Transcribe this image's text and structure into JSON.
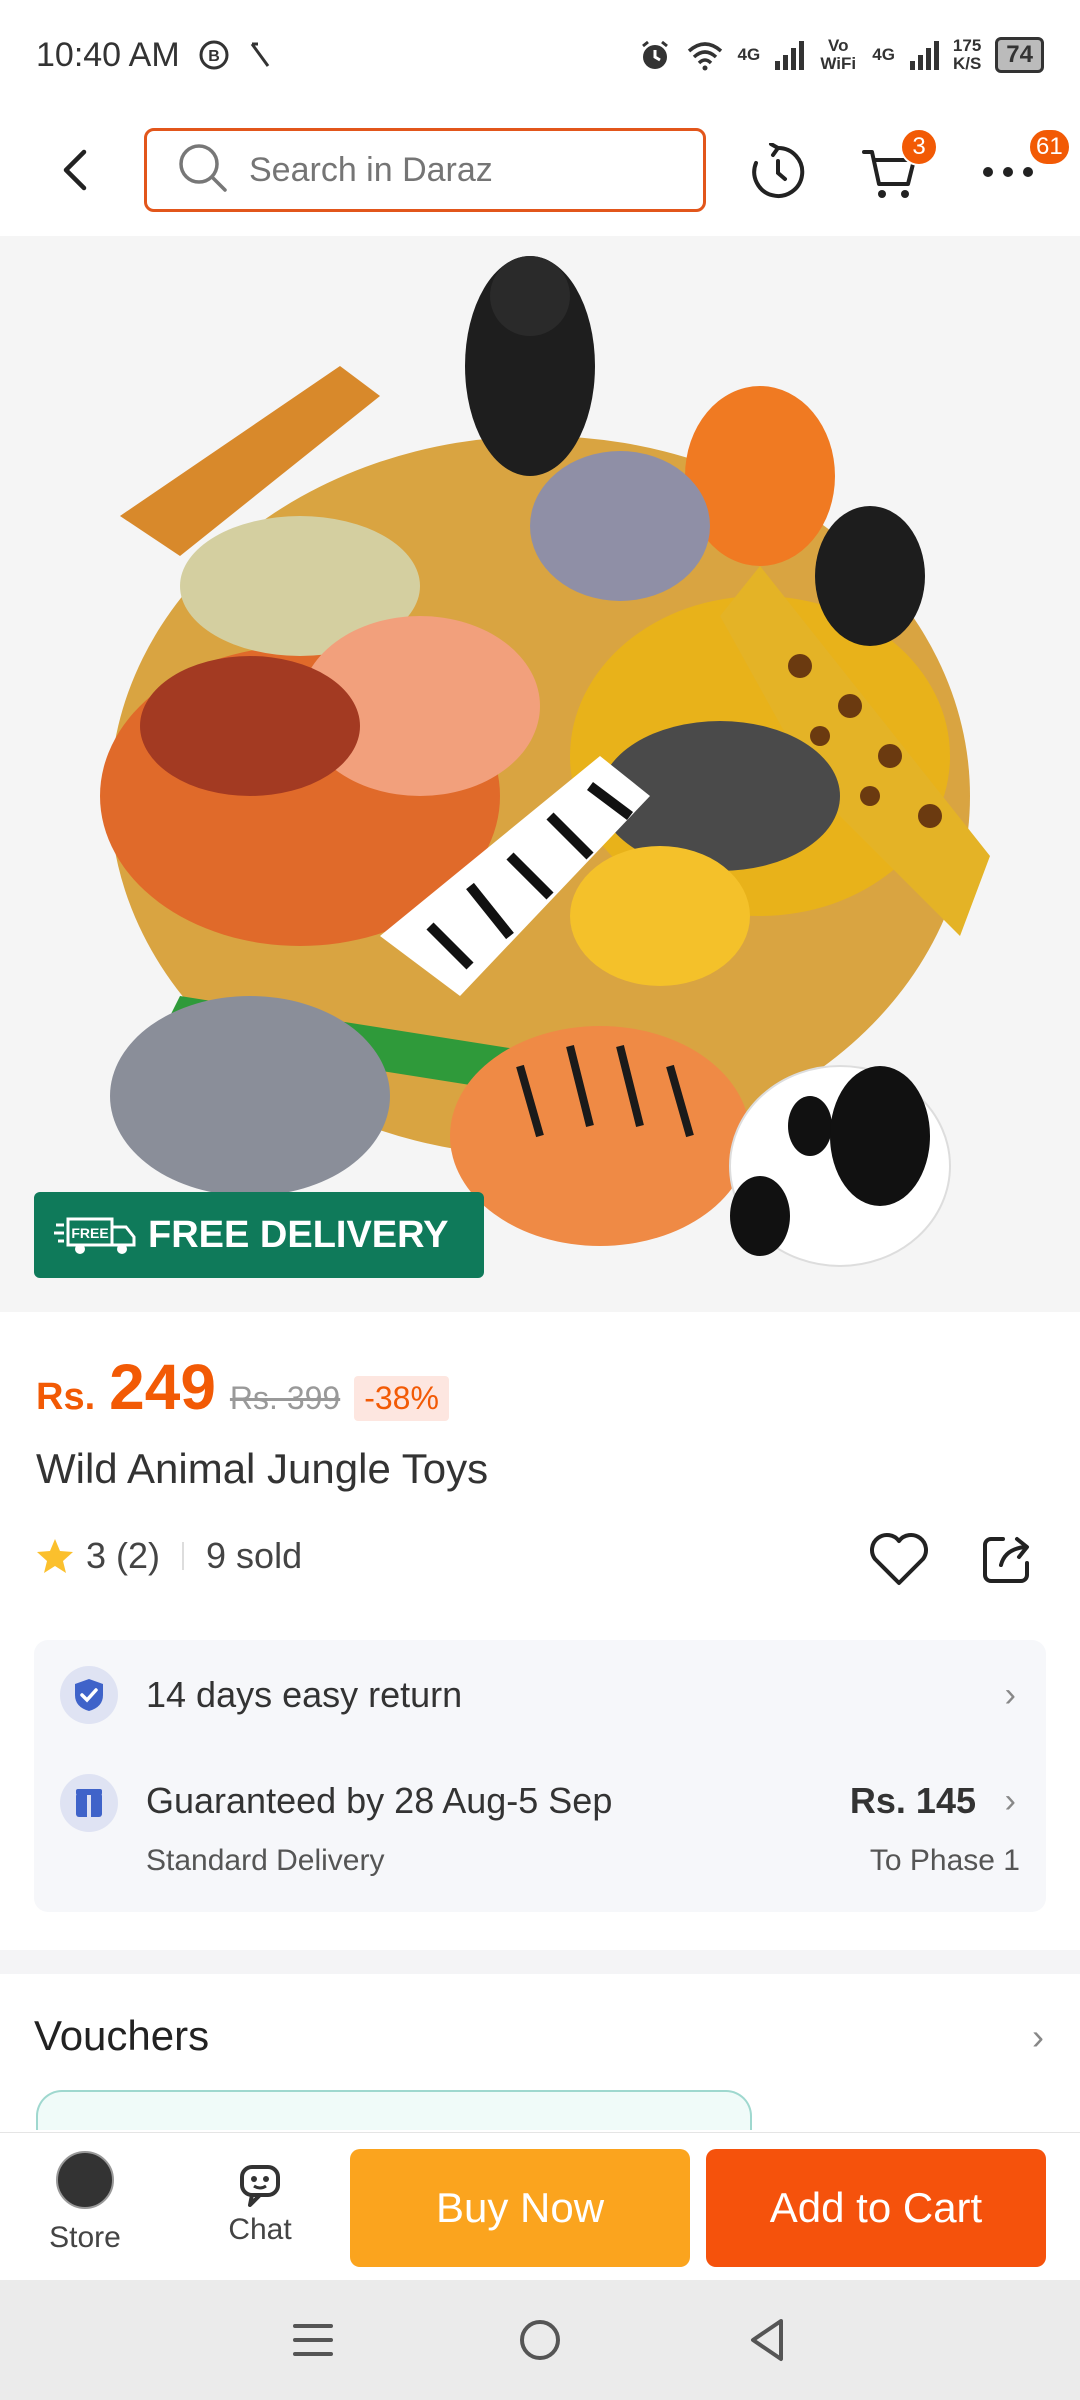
{
  "status_bar": {
    "time": "10:40 AM",
    "net_4g_a": "4G",
    "vowifi": "Vo WiFi",
    "net_4g_b": "4G",
    "speed_value": "175",
    "speed_unit": "K/S",
    "battery": "74"
  },
  "header": {
    "search_placeholder": "Search in Daraz",
    "cart_badge": "3",
    "more_badge": "61"
  },
  "product": {
    "free_delivery_label": "FREE DELIVERY",
    "free_tag": "FREE",
    "currency": "Rs.",
    "price": "249",
    "original_price": "Rs. 399",
    "discount": "-38%",
    "title": "Wild Animal Jungle Toys",
    "rating": "3",
    "rating_count": "(2)",
    "sold": "9 sold"
  },
  "info": {
    "return_text": "14 days easy return",
    "delivery_text": "Guaranteed by 28 Aug-5 Sep",
    "delivery_type": "Standard Delivery",
    "delivery_fee": "Rs. 145",
    "delivery_to": "To Phase 1"
  },
  "vouchers": {
    "title": "Vouchers"
  },
  "bottom": {
    "store_label": "Store",
    "chat_label": "Chat",
    "buy_now": "Buy Now",
    "add_to_cart": "Add to Cart"
  },
  "colors": {
    "accent": "#f25a05",
    "buy_now": "#fba41e",
    "free_delivery": "#0f7a5a"
  }
}
